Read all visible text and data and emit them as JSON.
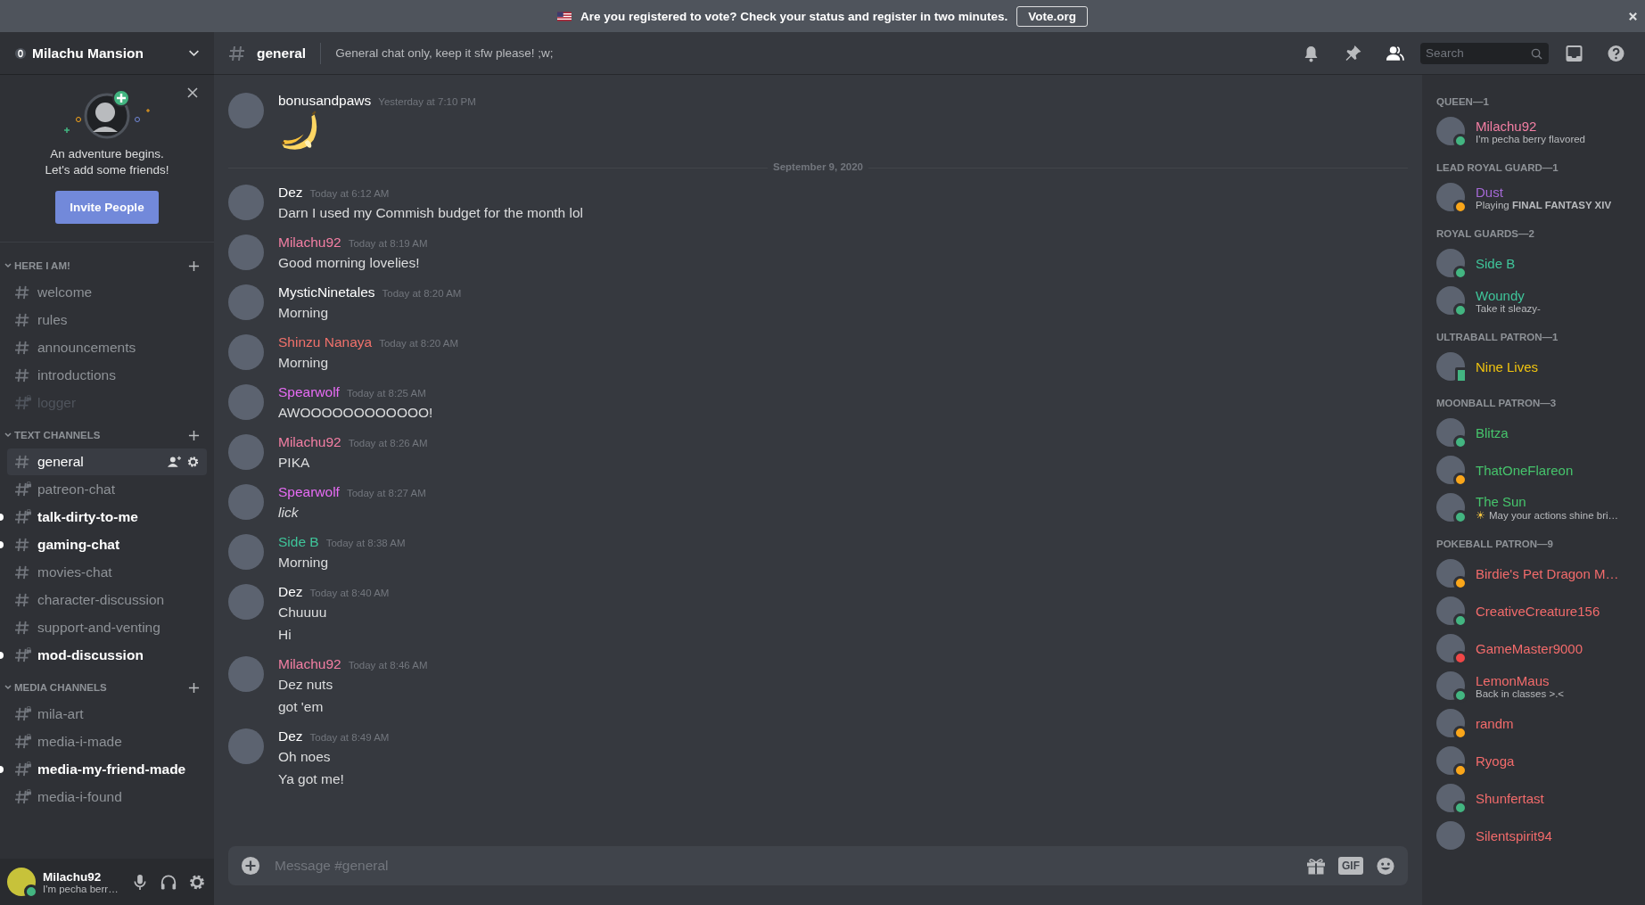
{
  "notice": {
    "text": "Are you registered to vote? Check your status and register in two minutes.",
    "button": "Vote.org"
  },
  "server": {
    "name": "Milachu Mansion"
  },
  "invite_card": {
    "lines": [
      "An adventure begins.",
      "Let's add some friends!"
    ],
    "button": "Invite People"
  },
  "categories": [
    {
      "name": "HERE I AM!",
      "expanded": true,
      "channels": [
        {
          "name": "welcome",
          "locked": false,
          "unread": false,
          "muted": false,
          "selected": false
        },
        {
          "name": "rules",
          "locked": false,
          "unread": false,
          "muted": false,
          "selected": false
        },
        {
          "name": "announcements",
          "locked": false,
          "unread": false,
          "muted": false,
          "selected": false
        },
        {
          "name": "introductions",
          "locked": false,
          "unread": false,
          "muted": false,
          "selected": false
        },
        {
          "name": "logger",
          "locked": true,
          "unread": false,
          "muted": true,
          "selected": false
        }
      ]
    },
    {
      "name": "TEXT CHANNELS",
      "expanded": true,
      "channels": [
        {
          "name": "general",
          "locked": false,
          "unread": false,
          "muted": false,
          "selected": true
        },
        {
          "name": "patreon-chat",
          "locked": true,
          "unread": false,
          "muted": false,
          "selected": false
        },
        {
          "name": "talk-dirty-to-me",
          "locked": true,
          "unread": true,
          "muted": false,
          "selected": false
        },
        {
          "name": "gaming-chat",
          "locked": false,
          "unread": true,
          "muted": false,
          "selected": false
        },
        {
          "name": "movies-chat",
          "locked": false,
          "unread": false,
          "muted": false,
          "selected": false
        },
        {
          "name": "character-discussion",
          "locked": false,
          "unread": false,
          "muted": false,
          "selected": false
        },
        {
          "name": "support-and-venting",
          "locked": false,
          "unread": false,
          "muted": false,
          "selected": false
        },
        {
          "name": "mod-discussion",
          "locked": true,
          "unread": true,
          "muted": false,
          "selected": false
        }
      ]
    },
    {
      "name": "MEDIA CHANNELS",
      "expanded": true,
      "channels": [
        {
          "name": "mila-art",
          "locked": true,
          "unread": false,
          "muted": false,
          "selected": false
        },
        {
          "name": "media-i-made",
          "locked": true,
          "unread": false,
          "muted": false,
          "selected": false
        },
        {
          "name": "media-my-friend-made",
          "locked": true,
          "unread": true,
          "muted": false,
          "selected": false
        },
        {
          "name": "media-i-found",
          "locked": true,
          "unread": false,
          "muted": false,
          "selected": false
        }
      ]
    }
  ],
  "user_panel": {
    "name": "Milachu92",
    "status": "I'm pecha berr…",
    "online": true
  },
  "channel_header": {
    "name": "general",
    "topic": "General chat only, keep it sfw please! ;w;",
    "search_placeholder": "Search"
  },
  "feed": [
    {
      "kind": "message",
      "author": "bonusandpaws",
      "color": "#ffffff",
      "time": "Yesterday at 7:10 PM",
      "lines": [
        {
          "kind": "emoji"
        }
      ]
    },
    {
      "kind": "divider",
      "text": "September 9, 2020"
    },
    {
      "kind": "message",
      "author": "Dez",
      "color": "#ffffff",
      "time": "Today at 6:12 AM",
      "lines": [
        {
          "kind": "text",
          "text": "Darn I used my Commish budget for the month lol",
          "italic": false
        }
      ]
    },
    {
      "kind": "message",
      "author": "Milachu92",
      "color": "#f47fa4",
      "time": "Today at 8:19 AM",
      "lines": [
        {
          "kind": "text",
          "text": "Good morning lovelies!",
          "italic": false
        }
      ]
    },
    {
      "kind": "message",
      "author": "MysticNinetales",
      "color": "#ffffff",
      "time": "Today at 8:20 AM",
      "lines": [
        {
          "kind": "text",
          "text": "Morning",
          "italic": false
        }
      ]
    },
    {
      "kind": "message",
      "author": "Shinzu Nanaya",
      "color": "#f0716b",
      "time": "Today at 8:20 AM",
      "lines": [
        {
          "kind": "text",
          "text": "Morning",
          "italic": false
        }
      ]
    },
    {
      "kind": "message",
      "author": "Spearwolf",
      "color": "#e86cf5",
      "time": "Today at 8:25 AM",
      "lines": [
        {
          "kind": "text",
          "text": "AWOOOOOOOOOOOO!",
          "italic": false
        }
      ]
    },
    {
      "kind": "message",
      "author": "Milachu92",
      "color": "#f47fa4",
      "time": "Today at 8:26 AM",
      "lines": [
        {
          "kind": "text",
          "text": "PIKA",
          "italic": false
        }
      ]
    },
    {
      "kind": "message",
      "author": "Spearwolf",
      "color": "#e86cf5",
      "time": "Today at 8:27 AM",
      "lines": [
        {
          "kind": "text",
          "text": "lick",
          "italic": true
        }
      ]
    },
    {
      "kind": "message",
      "author": "Side B",
      "color": "#3fc59a",
      "time": "Today at 8:38 AM",
      "lines": [
        {
          "kind": "text",
          "text": "Morning",
          "italic": false
        }
      ]
    },
    {
      "kind": "message",
      "author": "Dez",
      "color": "#ffffff",
      "time": "Today at 8:40 AM",
      "lines": [
        {
          "kind": "text",
          "text": "Chuuuu",
          "italic": false
        },
        {
          "kind": "text",
          "text": "Hi",
          "italic": false
        }
      ]
    },
    {
      "kind": "message",
      "author": "Milachu92",
      "color": "#f47fa4",
      "time": "Today at 8:46 AM",
      "lines": [
        {
          "kind": "text",
          "text": "Dez nuts",
          "italic": false
        },
        {
          "kind": "text",
          "text": "got 'em",
          "italic": false
        }
      ]
    },
    {
      "kind": "message",
      "author": "Dez",
      "color": "#ffffff",
      "time": "Today at 8:49 AM",
      "lines": [
        {
          "kind": "text",
          "text": "Oh noes",
          "italic": false
        },
        {
          "kind": "text",
          "text": "Ya got me!",
          "italic": false
        }
      ]
    }
  ],
  "composer": {
    "placeholder": "Message #general",
    "gif": "GIF"
  },
  "member_groups": [
    {
      "heading": "QUEEN—1",
      "members": [
        {
          "name": "Milachu92",
          "color": "#f47fa4",
          "kind": "online",
          "status": "I'm pecha berry flavored"
        }
      ]
    },
    {
      "heading": "LEAD ROYAL GUARD—1",
      "members": [
        {
          "name": "Dust",
          "color": "#a569d6",
          "kind": "idle",
          "status": "Playing **FINAL FANTASY XIV**"
        }
      ]
    },
    {
      "heading": "ROYAL GUARDS—2",
      "members": [
        {
          "name": "Side B",
          "color": "#3fc59a",
          "kind": "online"
        },
        {
          "name": "Woundy",
          "color": "#3fc59a",
          "kind": "online",
          "status": "Take it sleazy-"
        }
      ]
    },
    {
      "heading": "ULTRABALL PATRON—1",
      "members": [
        {
          "name": "Nine Lives",
          "color": "#f1c40f",
          "kind": "mobile"
        }
      ]
    },
    {
      "heading": "MOONBALL PATRON—3",
      "members": [
        {
          "name": "Blitza",
          "color": "#46c46c",
          "kind": "online"
        },
        {
          "name": "ThatOneFlareon",
          "color": "#46c46c",
          "kind": "idle"
        },
        {
          "name": "The Sun",
          "color": "#46c46c",
          "kind": "online",
          "status_emoji": "☀",
          "status": "May your actions shine bri…"
        }
      ]
    },
    {
      "heading": "POKEBALL PATRON—9",
      "members": [
        {
          "name": "Birdie's Pet Dragon M…",
          "color": "#f26b6b",
          "kind": "idle"
        },
        {
          "name": "CreativeCreature156",
          "color": "#f26b6b",
          "kind": "online"
        },
        {
          "name": "GameMaster9000",
          "color": "#f26b6b",
          "kind": "dnd"
        },
        {
          "name": "LemonMaus",
          "color": "#f26b6b",
          "kind": "online",
          "status": "Back in classes >.<"
        },
        {
          "name": "randm",
          "color": "#f26b6b",
          "kind": "idle"
        },
        {
          "name": "Ryoga",
          "color": "#f26b6b",
          "kind": "idle"
        },
        {
          "name": "Shunfertast",
          "color": "#f26b6b",
          "kind": "online"
        },
        {
          "name": "Silentspirit94",
          "color": "#f26b6b"
        }
      ]
    }
  ]
}
